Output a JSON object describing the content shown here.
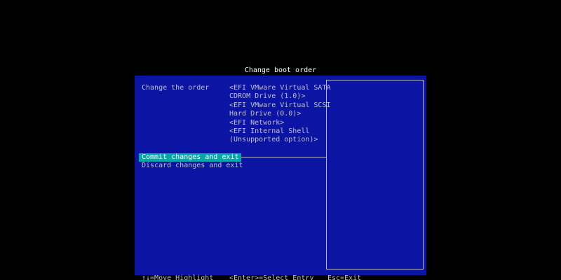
{
  "screen": {
    "title": "Change boot order",
    "colors": {
      "background": "#000000",
      "panel": "#0c14a4",
      "text": "#c0c0c0",
      "title_text": "#ffffff",
      "highlight": "#00a8a8"
    }
  },
  "form": {
    "label": "Change the order",
    "options": [
      "<EFI VMware Virtual SATA",
      "CDROM Drive (1.0)>",
      "<EFI VMware Virtual SCSI",
      "Hard Drive (0.0)>",
      "<EFI Network>",
      "<EFI Internal Shell",
      "(Unsupported option)>"
    ]
  },
  "actions": {
    "commit": "Commit changes and exit",
    "discard": "Discard changes and exit"
  },
  "footer": {
    "move": "↑↓=Move Highlight",
    "select": "<Enter>=Select Entry",
    "exit": "Esc=Exit"
  }
}
